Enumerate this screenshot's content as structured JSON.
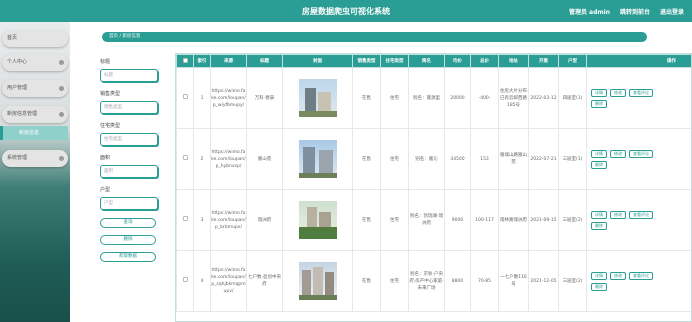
{
  "header": {
    "title": "房屋数据爬虫可视化系统",
    "admin": "管理员 admin",
    "front_link": "跳转到前台",
    "logout": "退出登录"
  },
  "sidebar": {
    "items": [
      {
        "label": "首页"
      },
      {
        "label": "个人中心"
      },
      {
        "label": "用户管理"
      },
      {
        "label": "新房信息管理"
      },
      {
        "label": "系统管理"
      }
    ],
    "active_sub": "新房信息"
  },
  "breadcrumb": {
    "home": "首页",
    "sep": "/",
    "current": "新房信息"
  },
  "filters": {
    "title_label": "标题",
    "title_placeholder": "标题",
    "type_label": "销售类型",
    "type_placeholder": "销售类型",
    "house_label": "住宅类型",
    "house_placeholder": "住宅类型",
    "area_label": "面积",
    "area_placeholder": "面积",
    "layout_label": "户型",
    "layout_placeholder": "户型",
    "query": "查询",
    "delete": "删除",
    "crawl": "爬取数据"
  },
  "table": {
    "headers": [
      "",
      "索引",
      "来源",
      "标题",
      "封面",
      "销售类型",
      "住宅类型",
      "简名",
      "均价",
      "总价",
      "地址",
      "开盘",
      "户型",
      "操作"
    ],
    "rows": [
      {
        "idx": "1",
        "src": "https://wimo.fa ke.com/loupan/p_wiyfbmupy/",
        "title": "万科·春辰",
        "sale": "在售",
        "house": "住宅",
        "alias": "别名：蓬源里",
        "avg": "20000",
        "total": "-400-",
        "addr": "住房大片分布已有云邮西路185号",
        "open": "2022-03-12",
        "layout": "四居室(1)"
      },
      {
        "idx": "2",
        "src": "https://wimo.fa ke.com/loupan/p_hybnxsp/",
        "title": "雁山苑",
        "sale": "在售",
        "house": "住宅",
        "alias": "别名：雁沁",
        "avg": "34500",
        "total": "153",
        "addr": "雁城山路雁山苑",
        "open": "2022-07-21",
        "layout": "三居室(1)"
      },
      {
        "idx": "3",
        "src": "https://wimo.fa ke.com/loupan/p_brbmupv/",
        "title": "瑞洲府",
        "sale": "在售",
        "house": "住宅",
        "alias": "别名：凯瑞澜·瑞洲府",
        "avg": "9000",
        "total": "100-117",
        "addr": "雨林路瑞洲府",
        "open": "2021-09-15",
        "layout": "三居室(2)"
      },
      {
        "idx": "4",
        "src": "https://wimo.fa ke.com/loupan/p_sqhjbkmqpmupv/",
        "title": "七户数·盈创中央府",
        "sale": "在售",
        "house": "住宅",
        "alias": "别名：京秋·户央府·房产中心家庭·未来广场",
        "avg": "8800",
        "total": "70-85",
        "addr": "一七户数116号",
        "open": "2021-12-05",
        "layout": "三居室(2)"
      }
    ],
    "op_detail": "详情",
    "op_edit": "修改",
    "op_comment": "查看评论",
    "op_delete": "删除"
  },
  "colors": {
    "accent": "#2a9d94"
  }
}
